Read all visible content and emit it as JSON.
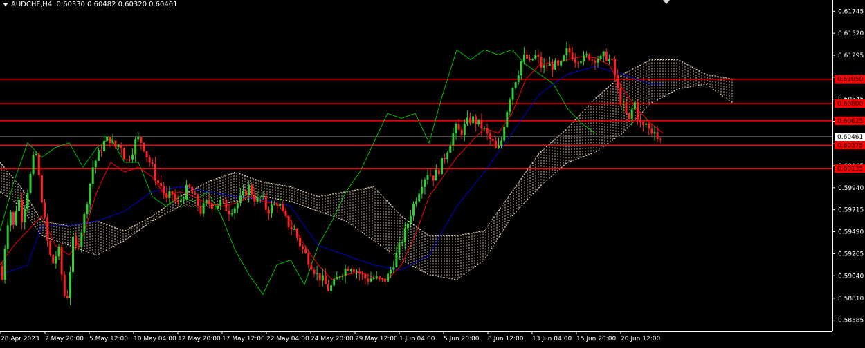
{
  "header": {
    "symbol_timeframe": "AUDCHF,H4",
    "ohlc": "0.60330 0.60482 0.60320 0.60461"
  },
  "chart_data": {
    "type": "candlestick",
    "symbol": "AUDCHF",
    "timeframe": "H4",
    "open": 0.6033,
    "high": 0.60482,
    "low": 0.6032,
    "close": 0.60461,
    "ylim": [
      0.5847,
      0.6186
    ],
    "y_ticks": [
      "0.61745",
      "0.61520",
      "0.61295",
      "0.61070",
      "0.60845",
      "0.60620",
      "0.60390",
      "0.60165",
      "0.59940",
      "0.59715",
      "0.59490",
      "0.59265",
      "0.59040",
      "0.58810",
      "0.58585"
    ],
    "x_ticks": [
      "28 Apr 2023",
      "2 May 20:00",
      "5 May 12:00",
      "10 May 04:00",
      "12 May 20:00",
      "17 May 12:00",
      "22 May 04:00",
      "24 May 20:00",
      "29 May 12:00",
      "1 Jun 04:00",
      "5 Jun 20:00",
      "8 Jun 12:00",
      "13 Jun 04:00",
      "15 Jun 20:00",
      "20 Jun 12:00"
    ],
    "horizontal_levels": [
      {
        "label": "0.61050",
        "value": 0.6105
      },
      {
        "label": "0.60800",
        "value": 0.608
      },
      {
        "label": "0.60625",
        "value": 0.60625
      },
      {
        "label": "0.60375",
        "value": 0.60375
      },
      {
        "label": "0.60135",
        "value": 0.60135
      }
    ],
    "current_price_label": "0.60461",
    "current_price": 0.60461,
    "colors": {
      "background": "#000000",
      "bull": "#32CD32",
      "bear": "#FF2020",
      "level": "#FF0000",
      "tenkan": "#FF0000",
      "kijun": "#0000CD",
      "chikou": "#00C000",
      "cloud": "#FFE4C4",
      "axis": "#FFFFFF"
    },
    "price_path": [
      [
        0,
        0.5914
      ],
      [
        3,
        0.59
      ],
      [
        8,
        0.5942
      ],
      [
        14,
        0.5975
      ],
      [
        20,
        0.5952
      ],
      [
        26,
        0.5988
      ],
      [
        32,
        0.5962
      ],
      [
        38,
        0.5985
      ],
      [
        45,
        0.601
      ],
      [
        51,
        0.6035
      ],
      [
        57,
        0.6
      ],
      [
        62,
        0.5975
      ],
      [
        67,
        0.5945
      ],
      [
        72,
        0.5925
      ],
      [
        78,
        0.5915
      ],
      [
        84,
        0.5935
      ],
      [
        90,
        0.59
      ],
      [
        95,
        0.5875
      ],
      [
        99,
        0.589
      ],
      [
        105,
        0.594
      ],
      [
        111,
        0.593
      ],
      [
        116,
        0.5945
      ],
      [
        122,
        0.5965
      ],
      [
        128,
        0.599
      ],
      [
        134,
        0.6015
      ],
      [
        142,
        0.6028
      ],
      [
        150,
        0.604
      ],
      [
        158,
        0.6045
      ],
      [
        166,
        0.6035
      ],
      [
        174,
        0.604
      ],
      [
        182,
        0.602
      ],
      [
        190,
        0.603
      ],
      [
        198,
        0.6045
      ],
      [
        206,
        0.604
      ],
      [
        213,
        0.6025
      ],
      [
        220,
        0.6015
      ],
      [
        227,
        0.6
      ],
      [
        234,
        0.5995
      ],
      [
        241,
        0.598
      ],
      [
        248,
        0.599
      ],
      [
        256,
        0.5975
      ],
      [
        264,
        0.5985
      ],
      [
        272,
        0.5995
      ],
      [
        280,
        0.5985
      ],
      [
        290,
        0.597
      ],
      [
        300,
        0.598
      ],
      [
        310,
        0.5975
      ],
      [
        320,
        0.598
      ],
      [
        330,
        0.597
      ],
      [
        340,
        0.5975
      ],
      [
        350,
        0.5985
      ],
      [
        360,
        0.5995
      ],
      [
        370,
        0.598
      ],
      [
        378,
        0.5985
      ],
      [
        386,
        0.597
      ],
      [
        394,
        0.5975
      ],
      [
        402,
        0.598
      ],
      [
        410,
        0.5965
      ],
      [
        418,
        0.5955
      ],
      [
        426,
        0.595
      ],
      [
        434,
        0.5935
      ],
      [
        442,
        0.5925
      ],
      [
        450,
        0.5915
      ],
      [
        458,
        0.5905
      ],
      [
        466,
        0.59
      ],
      [
        474,
        0.589
      ],
      [
        482,
        0.5895
      ],
      [
        490,
        0.5905
      ],
      [
        498,
        0.591
      ],
      [
        506,
        0.5915
      ],
      [
        514,
        0.591
      ],
      [
        522,
        0.5905
      ],
      [
        530,
        0.59
      ],
      [
        538,
        0.5902
      ],
      [
        546,
        0.59
      ],
      [
        554,
        0.5898
      ],
      [
        562,
        0.5905
      ],
      [
        570,
        0.592
      ],
      [
        578,
        0.5935
      ],
      [
        586,
        0.595
      ],
      [
        594,
        0.597
      ],
      [
        602,
        0.5985
      ],
      [
        610,
        0.6
      ],
      [
        618,
        0.601
      ],
      [
        626,
        0.6005
      ],
      [
        634,
        0.6012
      ],
      [
        642,
        0.6025
      ],
      [
        650,
        0.604
      ],
      [
        658,
        0.6055
      ],
      [
        666,
        0.605
      ],
      [
        674,
        0.606
      ],
      [
        682,
        0.6065
      ],
      [
        690,
        0.606
      ],
      [
        698,
        0.6055
      ],
      [
        706,
        0.6045
      ],
      [
        712,
        0.604
      ],
      [
        718,
        0.603
      ],
      [
        724,
        0.604
      ],
      [
        730,
        0.6065
      ],
      [
        736,
        0.6085
      ],
      [
        742,
        0.61
      ],
      [
        748,
        0.611
      ],
      [
        754,
        0.6125
      ],
      [
        760,
        0.6128
      ],
      [
        766,
        0.612
      ],
      [
        772,
        0.613
      ],
      [
        778,
        0.6125
      ],
      [
        784,
        0.6115
      ],
      [
        790,
        0.612
      ],
      [
        796,
        0.6118
      ],
      [
        802,
        0.612
      ],
      [
        808,
        0.6115
      ],
      [
        814,
        0.6125
      ],
      [
        820,
        0.6135
      ],
      [
        826,
        0.613
      ],
      [
        832,
        0.6125
      ],
      [
        838,
        0.6128
      ],
      [
        844,
        0.6125
      ],
      [
        850,
        0.613
      ],
      [
        856,
        0.6125
      ],
      [
        862,
        0.6128
      ],
      [
        868,
        0.6125
      ],
      [
        874,
        0.613
      ],
      [
        880,
        0.6125
      ],
      [
        886,
        0.612
      ],
      [
        892,
        0.6095
      ],
      [
        898,
        0.608
      ],
      [
        904,
        0.607
      ],
      [
        910,
        0.606
      ],
      [
        916,
        0.6085
      ],
      [
        922,
        0.6065
      ],
      [
        928,
        0.6055
      ],
      [
        934,
        0.606
      ],
      [
        940,
        0.605
      ],
      [
        946,
        0.6055
      ],
      [
        952,
        0.604
      ],
      [
        958,
        0.6046
      ]
    ],
    "tenkan_path": [
      [
        0,
        0.5915
      ],
      [
        20,
        0.5935
      ],
      [
        40,
        0.595
      ],
      [
        60,
        0.5965
      ],
      [
        80,
        0.5935
      ],
      [
        100,
        0.5925
      ],
      [
        120,
        0.5945
      ],
      [
        140,
        0.599
      ],
      [
        160,
        0.602
      ],
      [
        180,
        0.601
      ],
      [
        200,
        0.6015
      ],
      [
        220,
        0.6005
      ],
      [
        240,
        0.5985
      ],
      [
        260,
        0.599
      ],
      [
        280,
        0.5985
      ],
      [
        300,
        0.5978
      ],
      [
        320,
        0.5975
      ],
      [
        340,
        0.5978
      ],
      [
        360,
        0.5985
      ],
      [
        380,
        0.598
      ],
      [
        400,
        0.5978
      ],
      [
        420,
        0.596
      ],
      [
        440,
        0.5935
      ],
      [
        460,
        0.5915
      ],
      [
        480,
        0.59
      ],
      [
        500,
        0.5905
      ],
      [
        520,
        0.5908
      ],
      [
        540,
        0.5902
      ],
      [
        560,
        0.59
      ],
      [
        580,
        0.5915
      ],
      [
        600,
        0.5945
      ],
      [
        620,
        0.5985
      ],
      [
        640,
        0.6005
      ],
      [
        660,
        0.6025
      ],
      [
        680,
        0.604
      ],
      [
        700,
        0.6055
      ],
      [
        720,
        0.605
      ],
      [
        740,
        0.607
      ],
      [
        760,
        0.6105
      ],
      [
        780,
        0.612
      ],
      [
        800,
        0.6122
      ],
      [
        820,
        0.6125
      ],
      [
        840,
        0.6128
      ],
      [
        860,
        0.6127
      ],
      [
        880,
        0.612
      ],
      [
        900,
        0.6095
      ],
      [
        920,
        0.6075
      ],
      [
        940,
        0.606
      ],
      [
        958,
        0.605
      ]
    ],
    "kijun_path": [
      [
        0,
        0.5905
      ],
      [
        40,
        0.5915
      ],
      [
        60,
        0.5955
      ],
      [
        100,
        0.5955
      ],
      [
        140,
        0.596
      ],
      [
        180,
        0.597
      ],
      [
        220,
        0.599
      ],
      [
        260,
        0.5995
      ],
      [
        300,
        0.599
      ],
      [
        340,
        0.5985
      ],
      [
        380,
        0.5982
      ],
      [
        420,
        0.5975
      ],
      [
        460,
        0.5935
      ],
      [
        500,
        0.5925
      ],
      [
        540,
        0.5915
      ],
      [
        580,
        0.591
      ],
      [
        620,
        0.5925
      ],
      [
        660,
        0.5975
      ],
      [
        700,
        0.601
      ],
      [
        740,
        0.605
      ],
      [
        780,
        0.609
      ],
      [
        820,
        0.611
      ],
      [
        860,
        0.6118
      ],
      [
        900,
        0.611
      ],
      [
        940,
        0.61
      ],
      [
        958,
        0.61
      ]
    ],
    "chikou_path": [
      [
        0,
        0.595
      ],
      [
        20,
        0.6
      ],
      [
        40,
        0.604
      ],
      [
        60,
        0.6025
      ],
      [
        80,
        0.6035
      ],
      [
        100,
        0.604
      ],
      [
        120,
        0.6015
      ],
      [
        140,
        0.6035
      ],
      [
        160,
        0.6045
      ],
      [
        180,
        0.602
      ],
      [
        200,
        0.602
      ],
      [
        220,
        0.5985
      ],
      [
        240,
        0.5975
      ],
      [
        260,
        0.5985
      ],
      [
        280,
        0.598
      ],
      [
        300,
        0.599
      ],
      [
        320,
        0.5965
      ],
      [
        340,
        0.593
      ],
      [
        360,
        0.5905
      ],
      [
        380,
        0.5885
      ],
      [
        400,
        0.5915
      ],
      [
        420,
        0.592
      ],
      [
        440,
        0.5895
      ],
      [
        460,
        0.5935
      ],
      [
        480,
        0.596
      ],
      [
        500,
        0.599
      ],
      [
        520,
        0.601
      ],
      [
        540,
        0.604
      ],
      [
        560,
        0.607
      ],
      [
        580,
        0.6065
      ],
      [
        600,
        0.607
      ],
      [
        620,
        0.604
      ],
      [
        640,
        0.609
      ],
      [
        660,
        0.6135
      ],
      [
        680,
        0.6125
      ],
      [
        700,
        0.6135
      ],
      [
        720,
        0.613
      ],
      [
        740,
        0.6135
      ],
      [
        760,
        0.612
      ],
      [
        780,
        0.611
      ],
      [
        800,
        0.61
      ],
      [
        820,
        0.6075
      ],
      [
        840,
        0.606
      ],
      [
        860,
        0.605
      ]
    ],
    "cloud_upper": [
      [
        0,
        0.602
      ],
      [
        30,
        0.5995
      ],
      [
        60,
        0.596
      ],
      [
        100,
        0.5955
      ],
      [
        140,
        0.596
      ],
      [
        180,
        0.595
      ],
      [
        220,
        0.5965
      ],
      [
        260,
        0.5985
      ],
      [
        300,
        0.6
      ],
      [
        340,
        0.601
      ],
      [
        380,
        0.6
      ],
      [
        420,
        0.5995
      ],
      [
        460,
        0.5985
      ],
      [
        500,
        0.599
      ],
      [
        540,
        0.5995
      ],
      [
        580,
        0.5965
      ],
      [
        620,
        0.5945
      ],
      [
        660,
        0.5945
      ],
      [
        700,
        0.595
      ],
      [
        740,
        0.599
      ],
      [
        780,
        0.603
      ],
      [
        820,
        0.6055
      ],
      [
        860,
        0.6085
      ],
      [
        900,
        0.611
      ],
      [
        940,
        0.6125
      ],
      [
        980,
        0.6125
      ],
      [
        1020,
        0.611
      ],
      [
        1060,
        0.6105
      ]
    ],
    "cloud_lower": [
      [
        0,
        0.599
      ],
      [
        30,
        0.5975
      ],
      [
        60,
        0.5945
      ],
      [
        100,
        0.5935
      ],
      [
        140,
        0.5925
      ],
      [
        180,
        0.594
      ],
      [
        220,
        0.596
      ],
      [
        260,
        0.5975
      ],
      [
        300,
        0.5975
      ],
      [
        340,
        0.598
      ],
      [
        380,
        0.5985
      ],
      [
        420,
        0.598
      ],
      [
        460,
        0.597
      ],
      [
        500,
        0.596
      ],
      [
        540,
        0.594
      ],
      [
        580,
        0.592
      ],
      [
        620,
        0.5905
      ],
      [
        660,
        0.59
      ],
      [
        700,
        0.592
      ],
      [
        740,
        0.5965
      ],
      [
        780,
        0.5995
      ],
      [
        820,
        0.602
      ],
      [
        860,
        0.603
      ],
      [
        900,
        0.605
      ],
      [
        940,
        0.608
      ],
      [
        980,
        0.6095
      ],
      [
        1020,
        0.61
      ],
      [
        1060,
        0.608
      ]
    ]
  }
}
